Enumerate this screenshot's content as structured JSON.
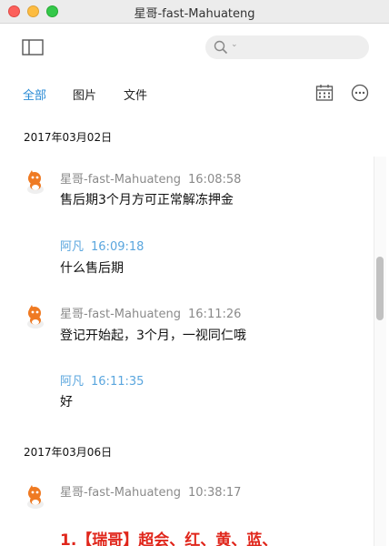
{
  "window": {
    "title": "星哥-fast-Mahuateng"
  },
  "search": {
    "placeholder": ""
  },
  "tabs": [
    "全部",
    "图片",
    "文件"
  ],
  "dates": [
    "2017年03月02日",
    "2017年03月06日"
  ],
  "messages": [
    {
      "sender": "星哥-fast-Mahuateng",
      "time": "16:08:58",
      "text": "售后期3个月方可正常解冻押金"
    },
    {
      "sender": "阿凡",
      "time": "16:09:18",
      "text": "什么售后期"
    },
    {
      "sender": "星哥-fast-Mahuateng",
      "time": "16:11:26",
      "text": "登记开始起，3个月，一视同仁哦"
    },
    {
      "sender": "阿凡",
      "time": "16:11:35",
      "text": "好"
    },
    {
      "sender": "星哥-fast-Mahuateng",
      "time": "10:38:17",
      "text": "1.【瑞哥】超会、红、黄、蓝、"
    }
  ],
  "colors": {
    "accent": "#2a8bd5",
    "self_name": "#5aa6de",
    "highlight_text": "#e0261b"
  }
}
